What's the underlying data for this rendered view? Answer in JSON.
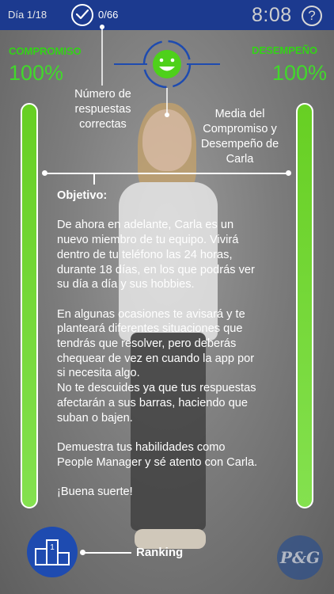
{
  "top_bar": {
    "day": "Día 1/18",
    "answers": "0/66",
    "clock": "8:08",
    "help": "?"
  },
  "left_panel": {
    "label": "COMPROMISO",
    "value": "100%",
    "level": 1.0
  },
  "right_panel": {
    "label": "DESEMPEÑO",
    "value": "100%",
    "level": 1.0
  },
  "callouts": {
    "correct_answers": [
      "Número de",
      "respuestas",
      "correctas"
    ],
    "average": [
      "Media del",
      "Compromiso y",
      "Desempeño de",
      "Carla"
    ]
  },
  "objective": {
    "title": "Objetivo:",
    "lines": [
      "De ahora en adelante, Carla es un",
      "nuevo miembro de tu equipo. Vivirá",
      "dentro de tu teléfono las 24 horas,",
      "durante 18 días, en los que podrás ver",
      "su día a día y sus hobbies.",
      "",
      "En algunas ocasiones te avisará y te",
      "planteará diferentes situaciones que",
      "tendrás que resolver, pero deberás",
      "chequear de vez en cuando la app por",
      "si necesita algo.",
      "No te descuides ya que tus respuestas",
      "afectarán a sus barras, haciendo que",
      "suban o bajen.",
      "",
      "Demuestra tus habilidades como",
      "People Manager y sé atento con Carla.",
      "",
      "¡Buena suerte!"
    ]
  },
  "ranking": {
    "label": "Ranking",
    "podium": "1"
  },
  "brand": {
    "logo_text": "P&G"
  },
  "colors": {
    "top_bar": "#1c3a8f",
    "accent_green": "#33d317",
    "ranking_button": "#1e4bb0"
  }
}
